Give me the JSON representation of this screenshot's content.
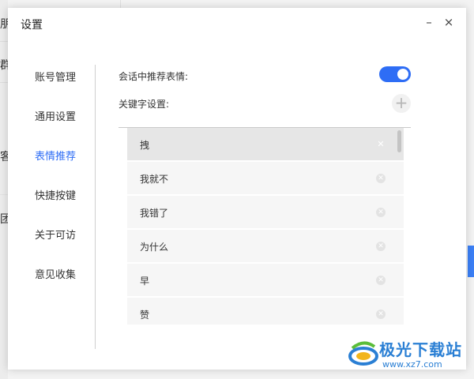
{
  "background": {
    "fragments": [
      "朋",
      "群",
      "客",
      "团"
    ]
  },
  "dialog": {
    "title": "设置",
    "minimize_glyph": "–",
    "close_glyph": "×"
  },
  "nav": {
    "items": [
      {
        "label": "账号管理",
        "active": false
      },
      {
        "label": "通用设置",
        "active": false
      },
      {
        "label": "表情推荐",
        "active": true
      },
      {
        "label": "快捷按键",
        "active": false
      },
      {
        "label": "关于可访",
        "active": false
      },
      {
        "label": "意见收集",
        "active": false
      }
    ]
  },
  "emoji_settings": {
    "recommend_label": "会话中推荐表情:",
    "recommend_enabled": true,
    "keywords_label": "关键字设置:",
    "add_glyph": "+",
    "keywords": [
      "拽",
      "我就不",
      "我错了",
      "为什么",
      "早",
      "赞"
    ],
    "selected_index": 0
  },
  "colors": {
    "accent": "#2e6df5"
  },
  "watermark": {
    "title": "极光下载站",
    "url": "www.xz7.com"
  }
}
